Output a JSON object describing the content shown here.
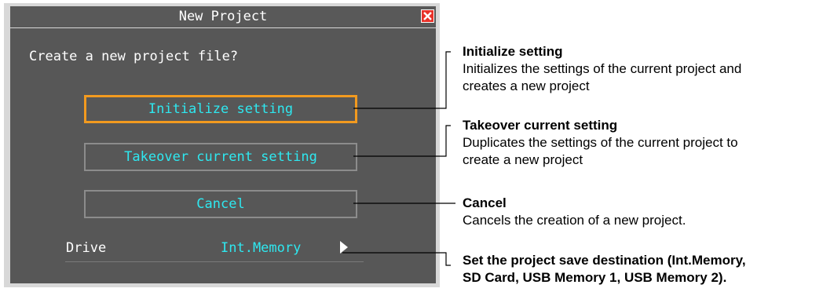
{
  "dialog": {
    "title": "New Project",
    "prompt": "Create a new project file?",
    "buttons": [
      {
        "label": "Initialize setting",
        "selected": true
      },
      {
        "label": "Takeover current setting",
        "selected": false
      },
      {
        "label": "Cancel",
        "selected": false
      }
    ],
    "drive": {
      "label": "Drive",
      "value": "Int.Memory"
    }
  },
  "annotations": [
    {
      "heading": "Initialize setting",
      "text": [
        "Initializes the settings of the current project and",
        "creates a new project"
      ]
    },
    {
      "heading": "Takeover current setting",
      "text": [
        "Duplicates the settings of the current project to",
        "create a new project"
      ]
    },
    {
      "heading": "Cancel",
      "text": [
        "Cancels the creation of a new project."
      ]
    },
    {
      "heading": "",
      "text_bold": [
        "Set the project save destination (Int.Memory,",
        "SD Card, USB Memory 1, USB Memory 2)."
      ]
    }
  ],
  "colors": {
    "accent": "#2ee8f0",
    "selection": "#f29a1f",
    "close": "#e8322a"
  }
}
